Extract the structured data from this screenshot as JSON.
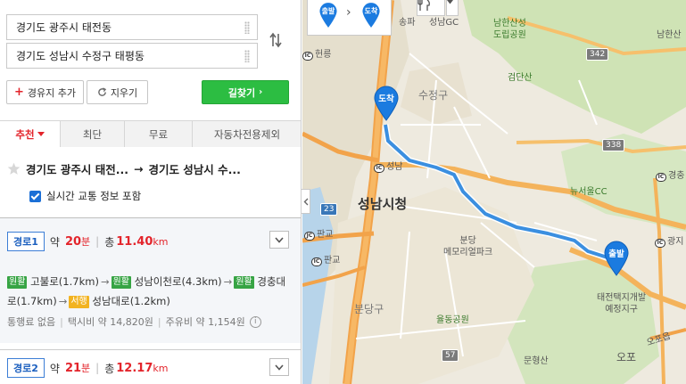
{
  "search": {
    "origin": "경기도 광주시 태전동",
    "destination": "경기도 성남시 수정구 태평동",
    "add_waypoint": "경유지 추가",
    "clear": "지우기",
    "go": "길찾기"
  },
  "tabs": [
    {
      "label": "추천"
    },
    {
      "label": "최단"
    },
    {
      "label": "무료"
    },
    {
      "label": "자동차전용제외"
    }
  ],
  "summary": {
    "from": "경기도 광주시 태전...",
    "arrow": "→",
    "to": "경기도 성남시 수...",
    "realtime": "실시간 교통 정보 포함"
  },
  "routes": [
    {
      "label": "경로1",
      "prefix_time": "약",
      "time_value": "20",
      "time_unit": "분",
      "prefix_dist": "총",
      "dist_value": "11.40",
      "dist_unit": "km",
      "segments": [
        {
          "badge": "원활",
          "badge_color": "green",
          "road": "고불로(1.7km)"
        },
        {
          "badge": "원활",
          "badge_color": "green",
          "road": "성남이천로(4.3km)"
        },
        {
          "badge": "원활",
          "badge_color": "green",
          "road": "경충대로(1.7km)"
        },
        {
          "badge": "서행",
          "badge_color": "yellow",
          "road": "성남대로(1.2km)"
        }
      ],
      "info": {
        "toll": "통행료 없음",
        "taxi": "택시비 약 14,820원",
        "fuel": "주유비 약 1,154원"
      }
    },
    {
      "label": "경로2",
      "prefix_time": "약",
      "time_value": "21",
      "time_unit": "분",
      "prefix_dist": "총",
      "dist_value": "12.17",
      "dist_unit": "km"
    }
  ],
  "map": {
    "pins": {
      "start": "출발",
      "end": "도착"
    },
    "labels": {
      "songpa": "송파",
      "seongnam_gc": "성남GC",
      "namhansanseong": "남한산성\n도립공원",
      "namhan_san": "남한산",
      "geomdan": "검단산",
      "sujeong": "수정구",
      "seongnam_ic": "성남",
      "seongnam_city": "성남시청",
      "newseoul_cc": "뉴서울CC",
      "bundang_memorial": "분당\n메모리얼파크",
      "pangyo_jc": "판교",
      "pangyo_ic": "판교",
      "bundang_gu": "분당구",
      "yuljeong": "율동공원",
      "munhyeongsan": "문형산",
      "gwangji": "광지",
      "taejeon": "태전택지개발\n예정지구",
      "opo": "오포읍",
      "heonreung": "헌릉",
      "ocheon": "오포",
      "gyeongchung": "경충"
    },
    "shields": [
      "342",
      "338",
      "23",
      "57"
    ],
    "dist_labels": [
      "57",
      "23"
    ]
  },
  "colors": {
    "accent_green": "#2cbd42",
    "accent_red": "#e3242b",
    "route_blue": "#3b8fe0",
    "pin_blue": "#1b7be0"
  }
}
